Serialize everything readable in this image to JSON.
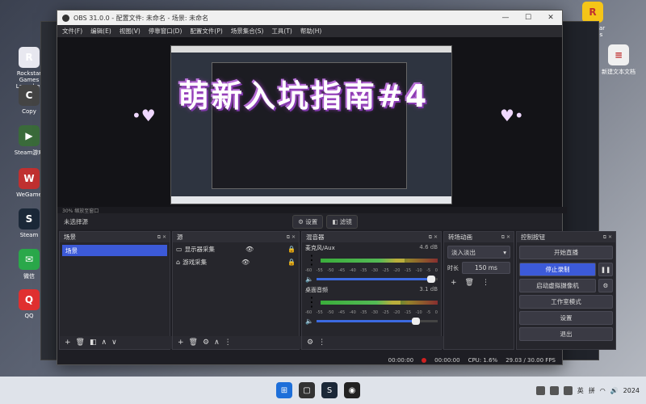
{
  "desktop": {
    "left_icons": [
      {
        "label": "Rockstar Games Launcher",
        "color": "#e8e8f0",
        "glyph": "R",
        "icon": "rockstar-icon"
      },
      {
        "label": "Copy",
        "color": "#444",
        "glyph": "C",
        "icon": "app-icon"
      },
      {
        "label": "Steam游戏",
        "color": "#3a6a3a",
        "glyph": "▶",
        "icon": "app-icon"
      },
      {
        "label": "WeGame",
        "color": "#c03030",
        "glyph": "W",
        "icon": "wegame-icon"
      },
      {
        "label": "Steam",
        "color": "#1b2838",
        "glyph": "S",
        "icon": "steam-icon"
      },
      {
        "label": "微信",
        "color": "#2aa84a",
        "glyph": "✉",
        "icon": "wechat-icon"
      },
      {
        "label": "QQ",
        "color": "#e03030",
        "glyph": "Q",
        "icon": "qq-icon"
      }
    ],
    "right_icons": [
      {
        "label": "Rockstar Games",
        "color": "#f5c518",
        "glyph": "R",
        "icon": "rockstar-icon"
      },
      {
        "label": "新建文本文档",
        "color": "#f0f0f0",
        "glyph": "≡",
        "icon": "text-file-icon"
      }
    ]
  },
  "obs": {
    "title": "OBS 31.0.0 - 配置文件: 未命名 - 场景: 未命名",
    "win_min": "—",
    "win_max": "☐",
    "win_close": "✕",
    "menu": [
      "文件(F)",
      "编辑(E)",
      "视图(V)",
      "停靠窗口(D)",
      "配置文件(P)",
      "场景集合(S)",
      "工具(T)",
      "帮助(H)"
    ],
    "headline": "萌新入坑指南#4",
    "heart_left": "•♥",
    "heart_right": "♥•",
    "zoom_status": "30%  缩放至窗口",
    "no_source": "未选择源",
    "properties_btn": "⚙ 设置",
    "filters_btn": "◧ 滤镜",
    "scenes": {
      "title": "场景",
      "items": [
        "场景"
      ]
    },
    "sources": {
      "title": "源",
      "items": [
        {
          "icon": "monitor-icon",
          "glyph": "▭",
          "label": "显示器采集"
        },
        {
          "icon": "gamepad-icon",
          "glyph": "⌂",
          "label": "游戏采集"
        }
      ]
    },
    "mixer": {
      "title": "混音器",
      "channels": [
        {
          "name": "麦克风/Aux",
          "db": "4.6 dB",
          "level": 0.72,
          "volume": 0.95
        },
        {
          "name": "桌面音频",
          "db": "3.1 dB",
          "level": 0.68,
          "volume": 0.82
        }
      ],
      "scale": [
        "-60",
        "-55",
        "-50",
        "-45",
        "-40",
        "-35",
        "-30",
        "-25",
        "-20",
        "-15",
        "-10",
        "-5",
        "0"
      ]
    },
    "transitions": {
      "title": "转场动画",
      "selected": "淡入淡出",
      "duration_label": "时长",
      "duration_value": "150 ms"
    },
    "controls": {
      "title": "控制按钮",
      "start_stream": "开始直播",
      "stop_record": "停止录制",
      "pause_icon": "❚❚",
      "virtual_cam": "启动虚拟摄像机",
      "studio_mode": "工作室模式",
      "settings": "设置",
      "exit": "退出"
    },
    "status": {
      "stream_time": "00:00:00",
      "rec_time": "00:00:00",
      "cpu": "CPU: 1.6%",
      "fps": "29.03 / 30.00 FPS"
    }
  },
  "taskbar": {
    "apps": [
      {
        "color": "#1e6fd9",
        "glyph": "⊞",
        "icon": "windows-start-icon"
      },
      {
        "color": "#333",
        "glyph": "▢",
        "icon": "task-view-icon"
      },
      {
        "color": "#1b2838",
        "glyph": "S",
        "icon": "steam-icon"
      },
      {
        "color": "#222",
        "glyph": "◉",
        "icon": "obs-icon"
      }
    ],
    "ime": "英",
    "ime2": "拼",
    "date": "2024"
  }
}
